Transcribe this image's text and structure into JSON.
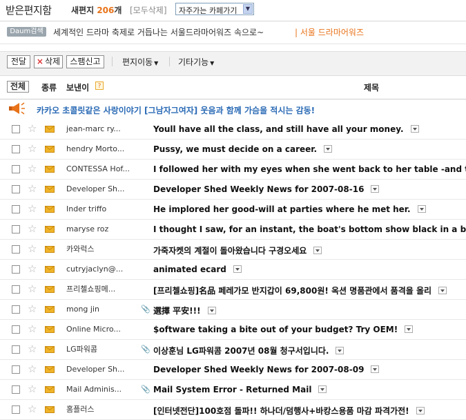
{
  "header": {
    "title": "받은편지함",
    "new_label": "새편지",
    "new_count": "206",
    "new_unit": "개",
    "delete_all": "[모두삭제]",
    "cafe_select": "자주가는 카페가기"
  },
  "ad": {
    "badge": "Daum검색",
    "text": "세계적인 드라마 축제로 거듭나는 서울드라마어워즈 속으로~",
    "link_sep": "|",
    "link": "서울 드라마어워즈"
  },
  "toolbar": {
    "forward": "전달",
    "delete": "삭제",
    "spam": "스팸신고",
    "move": "편지이동",
    "more": "기타기능"
  },
  "list_header": {
    "all": "전체",
    "type": "종류",
    "sender": "보낸이",
    "help": "?",
    "subject": "제목"
  },
  "promo": "카카오 초콜릿같은 사랑이야기 [그남자그여자] 웃음과 함께 가슴을 적시는 감동!",
  "colors": {
    "accent": "#e8731a",
    "promo": "#2a6ab5",
    "envelope": "#f0b429"
  },
  "emails": [
    {
      "sender": "jean-marc ry...",
      "attach": false,
      "subject": "Youll have all the class, and still have all your money."
    },
    {
      "sender": "hendry Morto...",
      "attach": false,
      "subject": "Pussy, we must decide on a career."
    },
    {
      "sender": "CONTESSA Hof...",
      "attach": false,
      "subject": "I followed her with my eyes when she went back to her table -and th"
    },
    {
      "sender": "Developer Sh...",
      "attach": false,
      "subject": "Developer Shed Weekly News for 2007-08-16"
    },
    {
      "sender": "Inder triffo",
      "attach": false,
      "subject": "He implored her good-will at parties where he met her."
    },
    {
      "sender": "maryse roz",
      "attach": false,
      "subject": "I thought I saw, for an instant, the boat's bottom show black in a bre"
    },
    {
      "sender": "카와럭스",
      "attach": false,
      "subject": "가죽자켓의 계절이 돌아왔습니다 구경오세요"
    },
    {
      "sender": "cutryjaclyn@...",
      "attach": false,
      "subject": "animated ecard"
    },
    {
      "sender": "프리첼쇼핑메...",
      "attach": false,
      "subject": "[프리첼쇼핑]名品 페레가모 반지갑이 69,800원! 옥션 명품관에서 품격을 올리"
    },
    {
      "sender": "mong jin",
      "attach": true,
      "subject": "選擇 平安!!!"
    },
    {
      "sender": "Online Micro...",
      "attach": false,
      "subject": "$oftware taking a bite out of your budget? Try OEM!"
    },
    {
      "sender": "LG파워콤",
      "attach": true,
      "subject": "이상훈님 LG파워콤 2007년 08월 청구서입니다."
    },
    {
      "sender": "Developer Sh...",
      "attach": false,
      "subject": "Developer Shed Weekly News for 2007-08-09"
    },
    {
      "sender": "Mail Adminis...",
      "attach": true,
      "subject": "Mail System Error - Returned Mail"
    },
    {
      "sender": "홈플러스",
      "attach": false,
      "subject": "[인터넷전단]100호점 돌파!! 하나더/덤행사+바캉스용품 마감 파격가전!"
    }
  ]
}
